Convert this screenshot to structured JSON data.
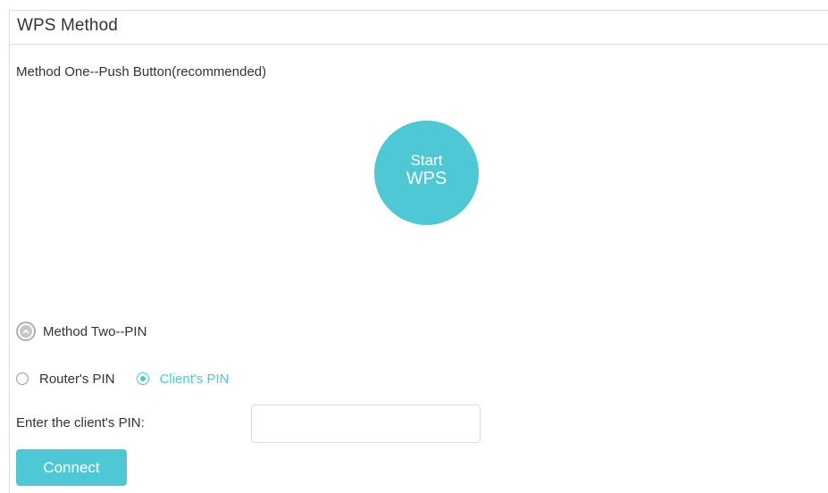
{
  "panel": {
    "title": "WPS Method"
  },
  "method_one": {
    "label": "Method One--Push Button(recommended)",
    "wps_button_line1": "Start",
    "wps_button_line2": "WPS"
  },
  "method_two": {
    "label": "Method Two--PIN",
    "toggle_icon": "chevron-up-icon",
    "options": [
      {
        "label": "Router's PIN",
        "checked": false
      },
      {
        "label": "Client's PIN",
        "checked": true
      }
    ],
    "pin_field_label": "Enter the client's PIN:",
    "pin_value": "",
    "connect_label": "Connect"
  },
  "colors": {
    "accent": "#4dc8d4",
    "text": "#333333",
    "border": "#dcdcdc"
  }
}
